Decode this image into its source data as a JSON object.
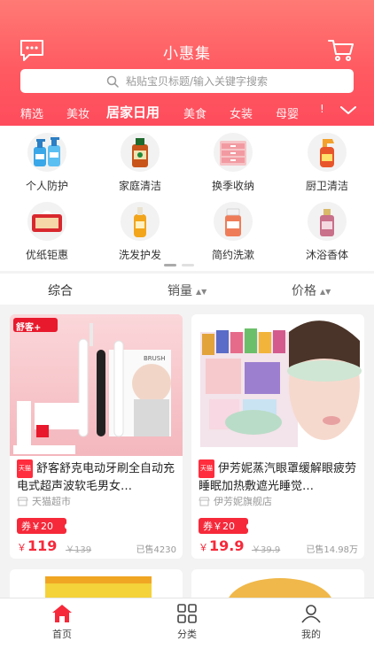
{
  "header": {
    "title": "小惠集",
    "search_placeholder": "粘贴宝贝标题/输入关键字搜索"
  },
  "tabs": [
    {
      "label": "精选",
      "active": false
    },
    {
      "label": "美妆",
      "active": false
    },
    {
      "label": "居家日用",
      "active": true
    },
    {
      "label": "美食",
      "active": false
    },
    {
      "label": "女装",
      "active": false
    },
    {
      "label": "母婴",
      "active": false
    }
  ],
  "tabs_more": "!",
  "categories": [
    {
      "label": "个人防护",
      "icon": "hand-sanitizer-icon"
    },
    {
      "label": "家庭清洁",
      "icon": "disinfectant-bottle-icon"
    },
    {
      "label": "换季收纳",
      "icon": "storage-drawer-icon"
    },
    {
      "label": "厨卫清洁",
      "icon": "spray-cleaner-icon"
    },
    {
      "label": "优纸钜惠",
      "icon": "tissue-paper-icon"
    },
    {
      "label": "洗发护发",
      "icon": "shampoo-icon"
    },
    {
      "label": "简约洗漱",
      "icon": "mouthwash-icon"
    },
    {
      "label": "沐浴香体",
      "icon": "body-mist-icon"
    }
  ],
  "sort": {
    "all": "综合",
    "sales": "销量",
    "price": "价格",
    "arrow": "▲▼"
  },
  "products": [
    {
      "title": "舒客舒克电动牙刷全自动充电式超声波软毛男女…",
      "badge": "天猫",
      "shop": "天猫超市",
      "coupon": "券￥20",
      "currency": "￥",
      "price": "119",
      "original": "￥139",
      "sold": "已售4230",
      "brand_on_image": "舒客+",
      "image_text": "BRUSH"
    },
    {
      "title": "伊芳妮蒸汽眼罩缓解眼疲劳睡眠加热敷遮光睡觉…",
      "badge": "天猫",
      "shop": "伊芳妮旗舰店",
      "coupon": "券￥20",
      "currency": "￥",
      "price": "19.9",
      "original": "￥39.9",
      "sold": "已售14.98万"
    }
  ],
  "bottom_nav": [
    {
      "label": "首页",
      "icon": "home-icon",
      "active": true
    },
    {
      "label": "分类",
      "icon": "grid-icon",
      "active": false
    },
    {
      "label": "我的",
      "icon": "user-icon",
      "active": false
    }
  ],
  "colors": {
    "accent": "#f6293a",
    "header_top": "#ff7a74",
    "header_bottom": "#fe4c5c"
  }
}
